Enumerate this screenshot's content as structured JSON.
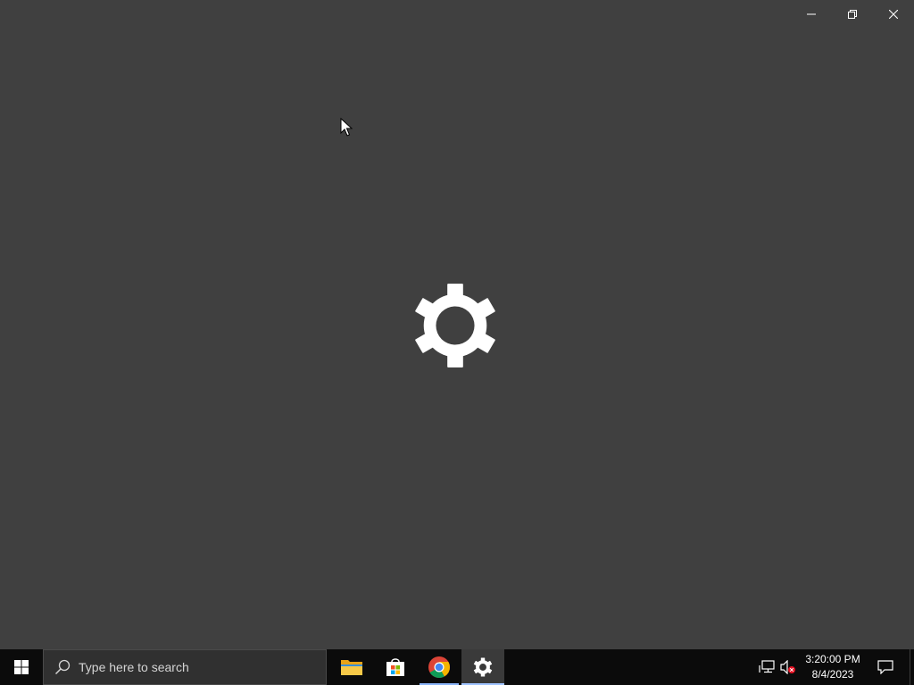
{
  "window": {
    "title": "Settings",
    "controls": {
      "minimize": "minimize-icon",
      "restore": "restore-icon",
      "close": "close-icon"
    },
    "splash_icon": "gear-icon"
  },
  "taskbar": {
    "start_icon": "windows-logo-icon",
    "search": {
      "placeholder": "Type here to search",
      "icon": "search-icon"
    },
    "apps": [
      {
        "name": "File Explorer",
        "icon": "folder-icon"
      },
      {
        "name": "Microsoft Store",
        "icon": "store-icon"
      },
      {
        "name": "Google Chrome",
        "icon": "chrome-icon"
      },
      {
        "name": "Settings",
        "icon": "gear-icon",
        "active": true
      }
    ],
    "tray": {
      "network_icon": "network-icon",
      "volume_icon": "volume-muted-icon",
      "time": "3:20:00 PM",
      "date": "8/4/2023",
      "notifications_icon": "action-center-icon"
    }
  },
  "colors": {
    "window_bg": "#404040",
    "taskbar_bg": "#0b0b0b",
    "search_bg": "#303030",
    "foreground": "#ffffff"
  }
}
